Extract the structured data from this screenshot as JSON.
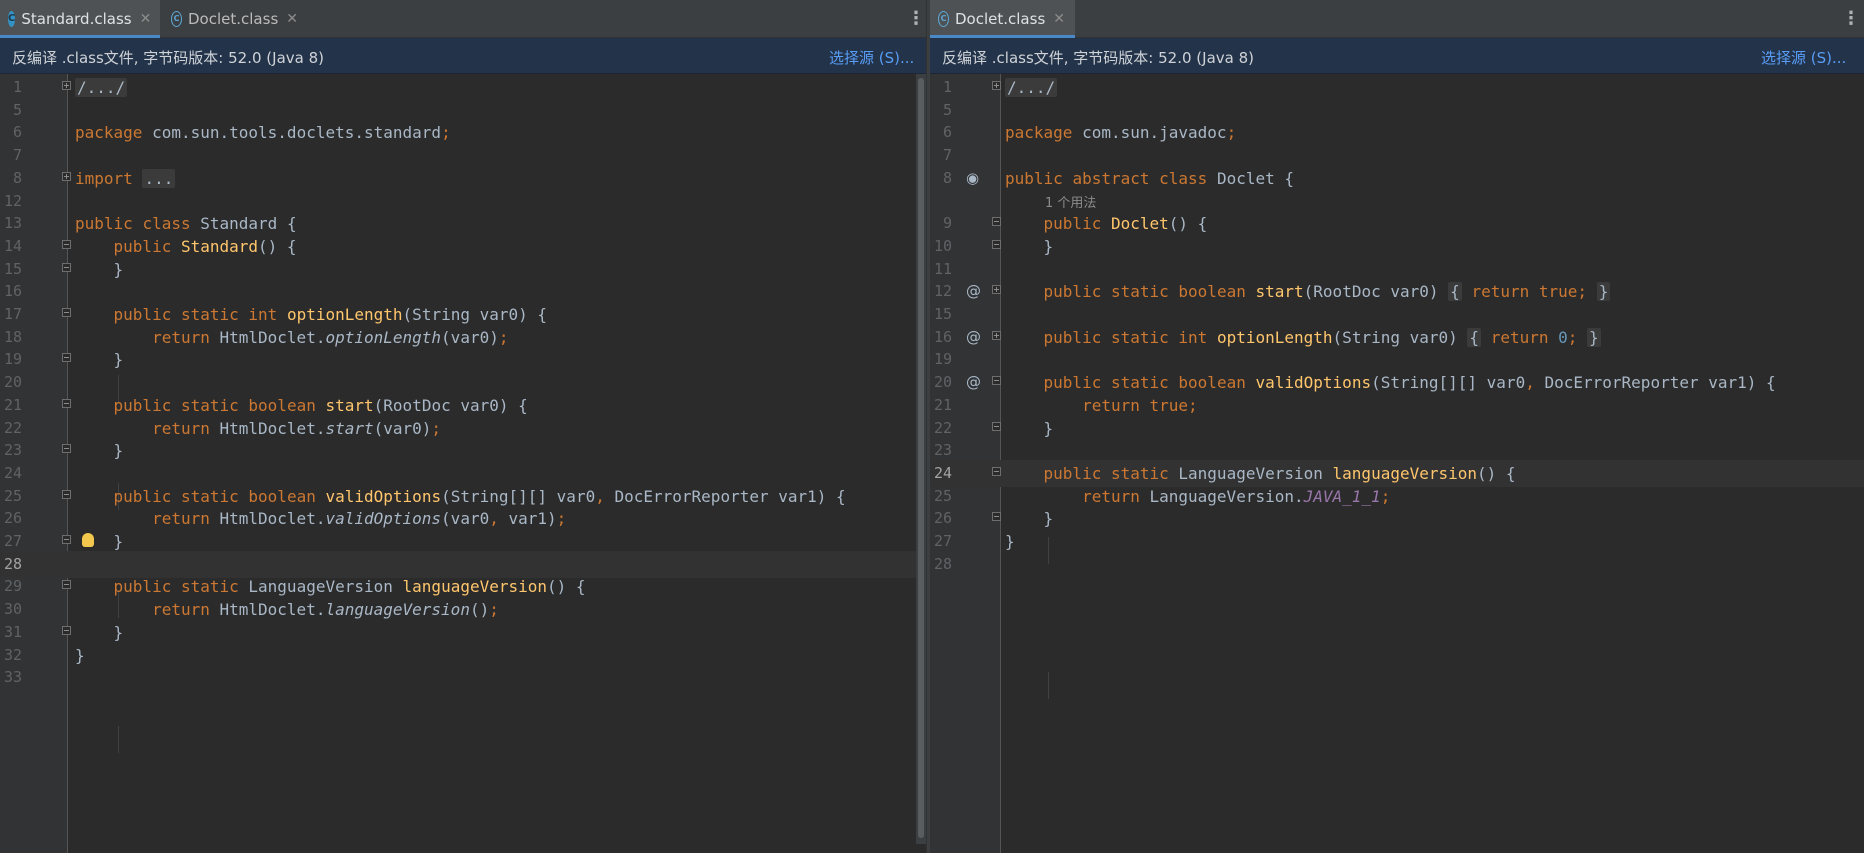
{
  "left": {
    "tabs": [
      {
        "label": "Standard.class",
        "icon": "class-icon",
        "active": true
      },
      {
        "label": "Doclet.class",
        "icon": "abstract-class-icon",
        "active": false
      }
    ],
    "banner": {
      "text": "反编译 .class文件, 字节码版本: 52.0 (Java 8)",
      "link": "选择源 (S)..."
    },
    "lines": [
      {
        "n": "1",
        "code": "/.../"
      },
      {
        "n": "5",
        "code": ""
      },
      {
        "n": "6",
        "code": "package com.sun.tools.doclets.standard;"
      },
      {
        "n": "7",
        "code": ""
      },
      {
        "n": "8",
        "code": "import ..."
      },
      {
        "n": "12",
        "code": ""
      },
      {
        "n": "13",
        "code": "public class Standard {"
      },
      {
        "n": "14",
        "code": "    public Standard() {"
      },
      {
        "n": "15",
        "code": "    }"
      },
      {
        "n": "16",
        "code": ""
      },
      {
        "n": "17",
        "code": "    public static int optionLength(String var0) {"
      },
      {
        "n": "18",
        "code": "        return HtmlDoclet.optionLength(var0);"
      },
      {
        "n": "19",
        "code": "    }"
      },
      {
        "n": "20",
        "code": ""
      },
      {
        "n": "21",
        "code": "    public static boolean start(RootDoc var0) {"
      },
      {
        "n": "22",
        "code": "        return HtmlDoclet.start(var0);"
      },
      {
        "n": "23",
        "code": "    }"
      },
      {
        "n": "24",
        "code": ""
      },
      {
        "n": "25",
        "code": "    public static boolean validOptions(String[][] var0, DocErrorReporter var1) {"
      },
      {
        "n": "26",
        "code": "        return HtmlDoclet.validOptions(var0, var1);"
      },
      {
        "n": "27",
        "code": "    }"
      },
      {
        "n": "28",
        "code": ""
      },
      {
        "n": "29",
        "code": "    public static LanguageVersion languageVersion() {"
      },
      {
        "n": "30",
        "code": "        return HtmlDoclet.languageVersion();"
      },
      {
        "n": "31",
        "code": "    }"
      },
      {
        "n": "32",
        "code": "}"
      },
      {
        "n": "33",
        "code": ""
      }
    ]
  },
  "right": {
    "tabs": [
      {
        "label": "Doclet.class",
        "icon": "abstract-class-icon",
        "active": true
      }
    ],
    "banner": {
      "text": "反编译 .class文件, 字节码版本: 52.0 (Java 8)",
      "link": "选择源 (S)..."
    },
    "hint": "1 个用法",
    "lines": [
      {
        "n": "1",
        "code": "/.../"
      },
      {
        "n": "5",
        "code": ""
      },
      {
        "n": "6",
        "code": "package com.sun.javadoc;"
      },
      {
        "n": "7",
        "code": ""
      },
      {
        "n": "8",
        "code": "public abstract class Doclet {"
      },
      {
        "n": "",
        "code": "1 个用法"
      },
      {
        "n": "9",
        "code": "    public Doclet() {"
      },
      {
        "n": "10",
        "code": "    }"
      },
      {
        "n": "11",
        "code": ""
      },
      {
        "n": "12",
        "code": "    public static boolean start(RootDoc var0) { return true; }"
      },
      {
        "n": "15",
        "code": ""
      },
      {
        "n": "16",
        "code": "    public static int optionLength(String var0) { return 0; }"
      },
      {
        "n": "19",
        "code": ""
      },
      {
        "n": "20",
        "code": "    public static boolean validOptions(String[][] var0, DocErrorReporter var1) {"
      },
      {
        "n": "21",
        "code": "        return true;"
      },
      {
        "n": "22",
        "code": "    }"
      },
      {
        "n": "23",
        "code": ""
      },
      {
        "n": "24",
        "code": "    public static LanguageVersion languageVersion() {"
      },
      {
        "n": "25",
        "code": "        return LanguageVersion.JAVA_1_1;"
      },
      {
        "n": "26",
        "code": "    }"
      },
      {
        "n": "27",
        "code": "}"
      },
      {
        "n": "28",
        "code": ""
      }
    ]
  },
  "colors": {
    "keyword": "#cc7832",
    "method": "#ffc66d",
    "constant": "#9876aa",
    "number": "#6897bb",
    "text": "#a9b7c6",
    "banner_bg": "#233349",
    "link": "#589df6"
  }
}
